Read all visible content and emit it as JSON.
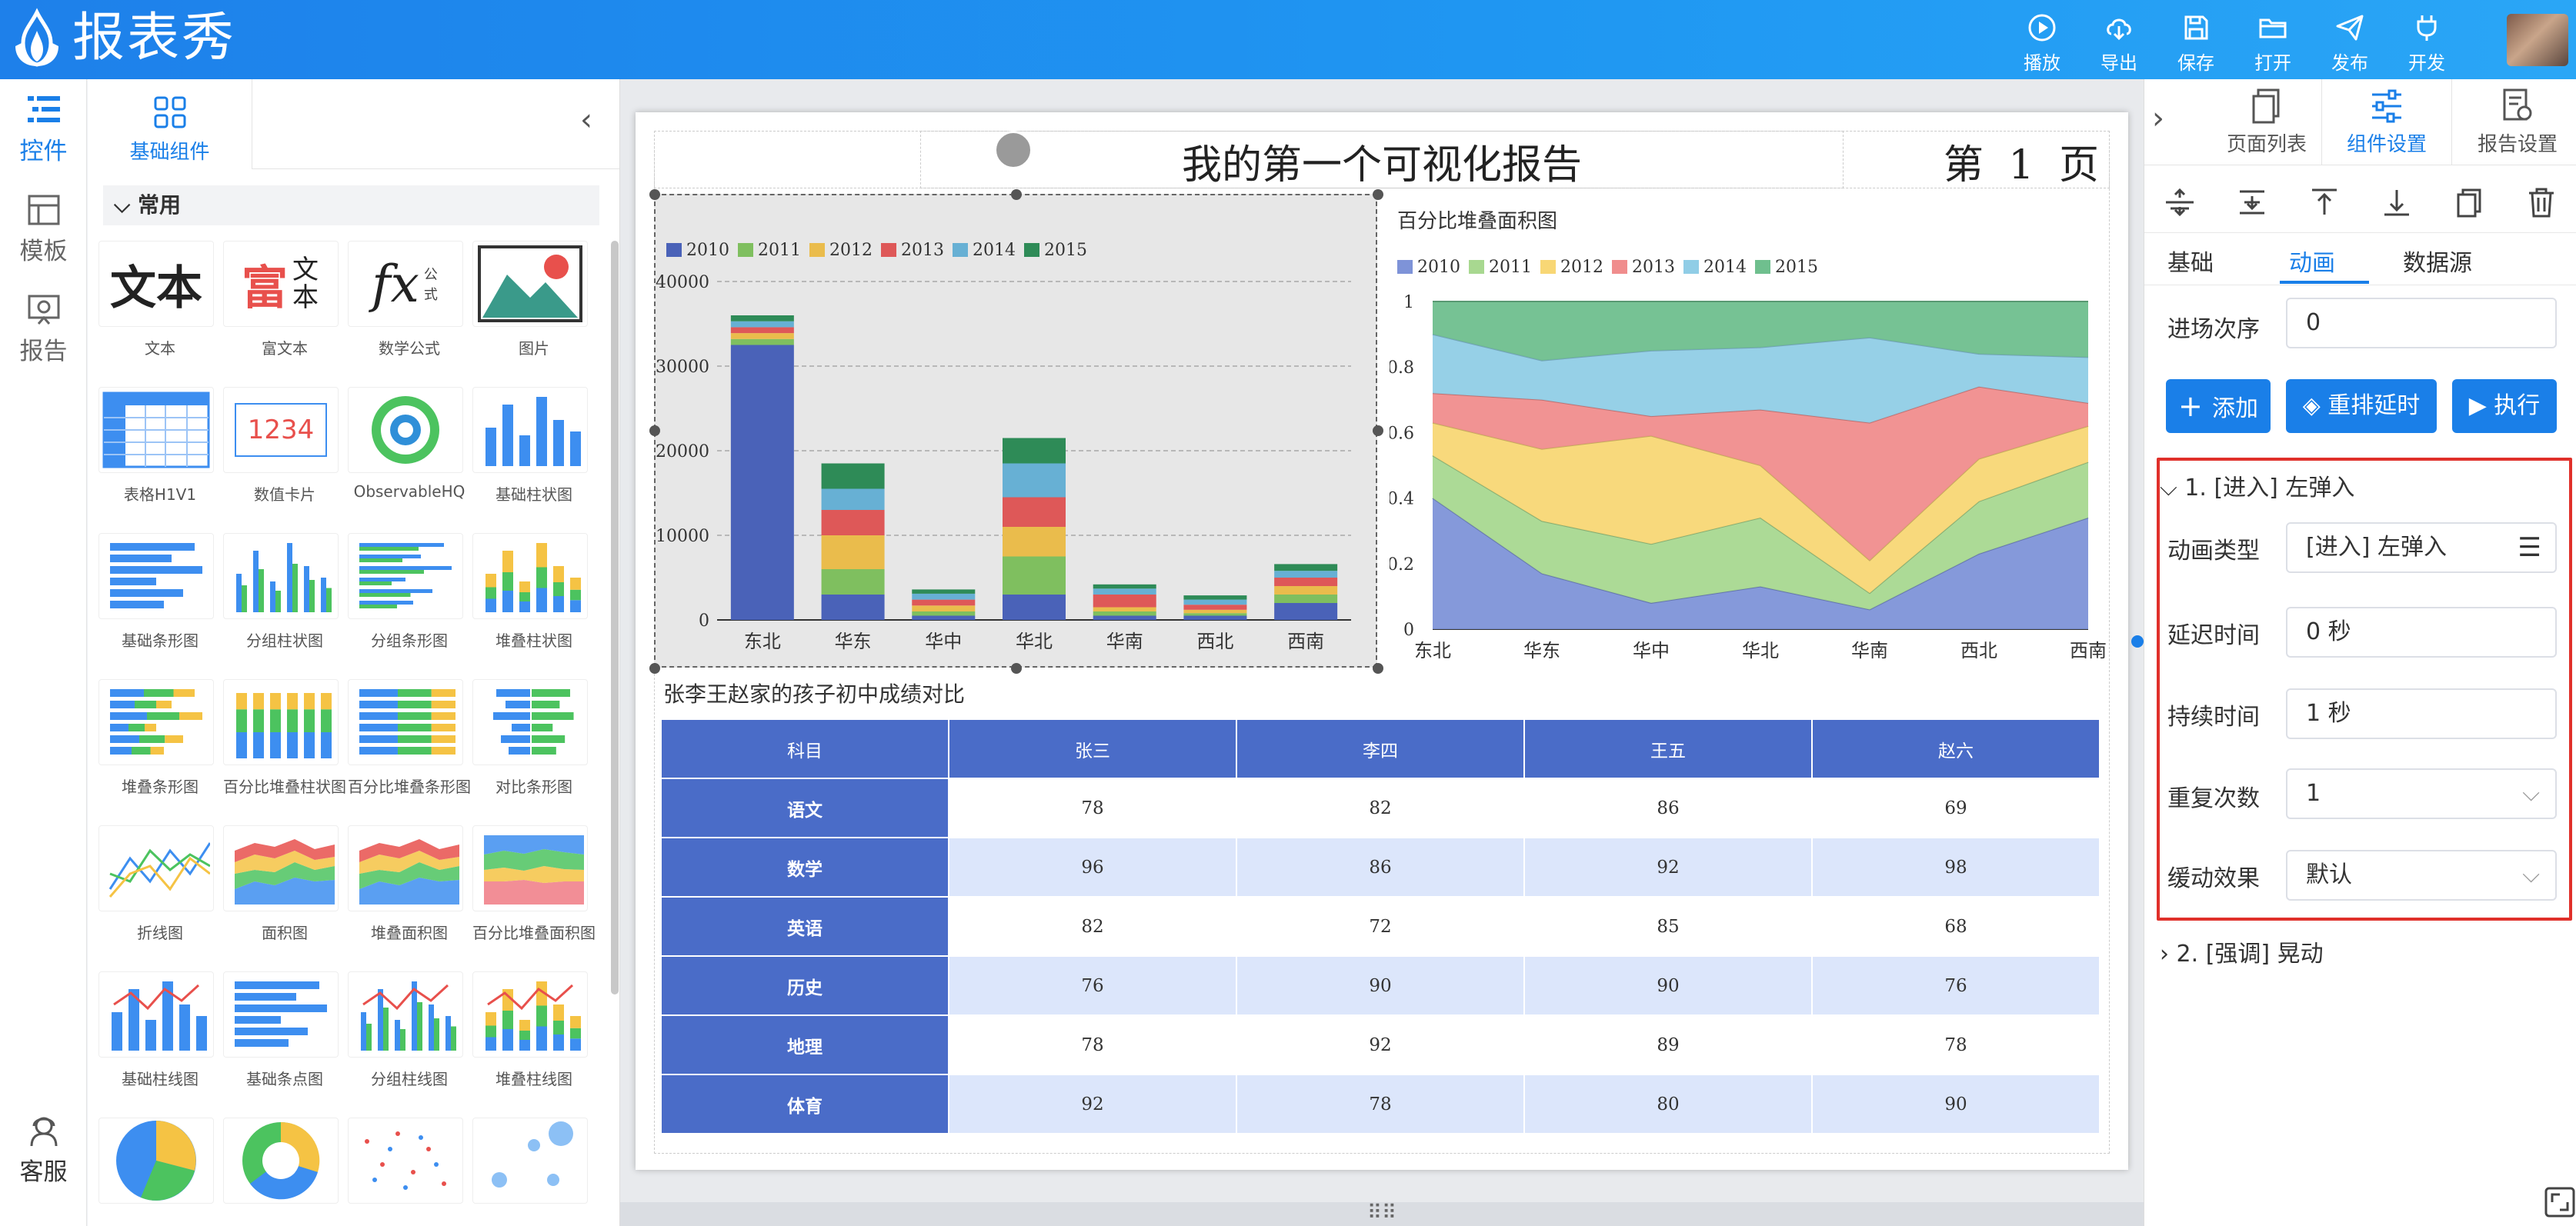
{
  "app": {
    "name": "报表秀"
  },
  "toolbar": {
    "items": [
      {
        "label": "播放",
        "icon": "play-icon"
      },
      {
        "label": "导出",
        "icon": "download-icon"
      },
      {
        "label": "保存",
        "icon": "save-icon"
      },
      {
        "label": "打开",
        "icon": "folder-icon"
      },
      {
        "label": "发布",
        "icon": "send-icon"
      },
      {
        "label": "开发",
        "icon": "plug-icon"
      }
    ]
  },
  "rail": {
    "items": [
      {
        "label": "控件",
        "active": true
      },
      {
        "label": "模板",
        "active": false
      },
      {
        "label": "报告",
        "active": false
      }
    ],
    "support": "客服"
  },
  "library": {
    "tab": "基础组件",
    "section": "常用",
    "items": [
      "文本",
      "富文本",
      "数学公式",
      "图片",
      "表格H1V1",
      "数值卡片",
      "ObservableHQ",
      "基础柱状图",
      "基础条形图",
      "分组柱状图",
      "分组条形图",
      "堆叠柱状图",
      "堆叠条形图",
      "百分比堆叠柱状图",
      "百分比堆叠条形图",
      "对比条形图",
      "折线图",
      "面积图",
      "堆叠面积图",
      "百分比堆叠面积图",
      "基础柱线图",
      "基础条点图",
      "分组柱线图",
      "堆叠柱线图"
    ],
    "thumb_text": {
      "text": "文本",
      "richtext_a": "富",
      "richtext_b": "文",
      "richtext_c": "本",
      "math_a": "公",
      "math_b": "式",
      "card": "1234"
    }
  },
  "report": {
    "title": "我的第一个可视化报告",
    "page_label": "第 1 页",
    "table_title": "张李王赵家的孩子初中成绩对比",
    "table": {
      "headers": [
        "科目",
        "张三",
        "李四",
        "王五",
        "赵六"
      ],
      "rows": [
        [
          "语文",
          "78",
          "82",
          "86",
          "69"
        ],
        [
          "数学",
          "96",
          "86",
          "92",
          "98"
        ],
        [
          "英语",
          "82",
          "72",
          "85",
          "68"
        ],
        [
          "历史",
          "76",
          "90",
          "90",
          "76"
        ],
        [
          "地理",
          "78",
          "92",
          "89",
          "78"
        ],
        [
          "体育",
          "92",
          "78",
          "80",
          "90"
        ]
      ]
    }
  },
  "chart_data": [
    {
      "type": "bar",
      "stacked": true,
      "categories": [
        "东北",
        "华东",
        "华中",
        "华北",
        "华南",
        "西北",
        "西南"
      ],
      "ylim": [
        0,
        40000
      ],
      "yticks": [
        "0",
        "10000",
        "20000",
        "30000",
        "40000"
      ],
      "legend_position": "top-left",
      "series": [
        {
          "name": "2010",
          "color": "#4a62b8",
          "values": [
            32500,
            3000,
            500,
            3000,
            500,
            500,
            2000
          ]
        },
        {
          "name": "2011",
          "color": "#7fbf5f",
          "values": [
            700,
            3000,
            500,
            4500,
            500,
            300,
            1000
          ]
        },
        {
          "name": "2012",
          "color": "#eabc4c",
          "values": [
            700,
            4000,
            700,
            3500,
            500,
            400,
            1000
          ]
        },
        {
          "name": "2013",
          "color": "#de5858",
          "values": [
            700,
            3000,
            700,
            3500,
            1500,
            600,
            1000
          ]
        },
        {
          "name": "2014",
          "color": "#67b0d4",
          "values": [
            700,
            2500,
            700,
            4000,
            700,
            600,
            800
          ]
        },
        {
          "name": "2015",
          "color": "#2e8b57",
          "values": [
            700,
            3000,
            500,
            3000,
            500,
            500,
            800
          ]
        }
      ]
    },
    {
      "type": "area",
      "stacked": true,
      "title": "百分比堆叠面积图",
      "categories": [
        "东北",
        "华东",
        "华中",
        "华北",
        "华南",
        "西北",
        "西南"
      ],
      "ylim": [
        0,
        1
      ],
      "yticks": [
        "0",
        "0.2",
        "0.4",
        "0.6",
        "0.8",
        "1"
      ],
      "legend_position": "top-left",
      "series": [
        {
          "name": "2010",
          "color": "#7e93d8",
          "values": [
            0.4,
            0.17,
            0.08,
            0.13,
            0.06,
            0.23,
            0.34
          ]
        },
        {
          "name": "2011",
          "color": "#a8d890",
          "values": [
            0.13,
            0.16,
            0.18,
            0.21,
            0.05,
            0.16,
            0.17
          ]
        },
        {
          "name": "2012",
          "color": "#f8d775",
          "values": [
            0.1,
            0.22,
            0.33,
            0.16,
            0.1,
            0.13,
            0.11
          ]
        },
        {
          "name": "2013",
          "color": "#f08d8d",
          "values": [
            0.09,
            0.15,
            0.06,
            0.17,
            0.42,
            0.22,
            0.07
          ]
        },
        {
          "name": "2014",
          "color": "#90cde6",
          "values": [
            0.18,
            0.12,
            0.2,
            0.19,
            0.26,
            0.1,
            0.14
          ]
        },
        {
          "name": "2015",
          "color": "#6fbf8e",
          "values": [
            0.1,
            0.18,
            0.15,
            0.14,
            0.11,
            0.16,
            0.17
          ]
        }
      ]
    }
  ],
  "right_panel": {
    "tabs": [
      {
        "label": "页面列表",
        "active": false
      },
      {
        "label": "组件设置",
        "active": true
      },
      {
        "label": "报告设置",
        "active": false
      }
    ],
    "subtabs": [
      {
        "label": "基础",
        "active": false
      },
      {
        "label": "动画",
        "active": true
      },
      {
        "label": "数据源",
        "active": false
      }
    ],
    "order_label": "进场次序",
    "order_value": "0",
    "buttons": {
      "add": "添加",
      "reorder": "重排延时",
      "run": "执行"
    },
    "animation1": {
      "header": "1. [进入] 左弹入",
      "type_label": "动画类型",
      "type_value": "[进入] 左弹入",
      "delay_label": "延迟时间",
      "delay_value": "0 秒",
      "duration_label": "持续时间",
      "duration_value": "1 秒",
      "repeat_label": "重复次数",
      "repeat_value": "1",
      "easing_label": "缓动效果",
      "easing_value": "默认"
    },
    "animation2": {
      "header": "2. [强调] 晃动"
    }
  }
}
